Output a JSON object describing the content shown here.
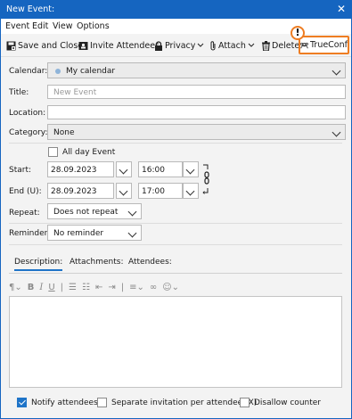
{
  "window": {
    "title": "New Event:",
    "close_glyph": "✕"
  },
  "menu": [
    {
      "label": "Event"
    },
    {
      "label": "Edit"
    },
    {
      "label": "View"
    },
    {
      "label": "Options"
    }
  ],
  "toolbar": {
    "save_close": "Save and Close",
    "invite": "Invite Attendees",
    "privacy": "Privacy",
    "attach": "Attach",
    "delete": "Delete",
    "trueconf": "TrueConf",
    "alert_glyph": "!",
    "accent_color": "#ee7d22"
  },
  "form": {
    "calendar_label": "Calendar:",
    "calendar_value": "My calendar",
    "title_label": "Title:",
    "title_placeholder": "New Event",
    "location_label": "Location:",
    "location_value": "",
    "category_label": "Category:",
    "category_value": "None",
    "allday_label": "All day Event",
    "allday_checked": false,
    "start_label": "Start:",
    "start_date": "28.09.2023",
    "start_time": "16:00",
    "end_label": "End (U):",
    "end_date": "28.09.2023",
    "end_time": "17:00",
    "repeat_label": "Repeat:",
    "repeat_value": "Does not repeat",
    "reminder_label": "Reminder:",
    "reminder_value": "No reminder"
  },
  "tabs": [
    {
      "label": "Description:",
      "active": true
    },
    {
      "label": "Attachments:",
      "active": false
    },
    {
      "label": "Attendees:",
      "active": false
    }
  ],
  "format_toolbar": [
    "paragraph-icon",
    "bold-icon",
    "italic-icon",
    "underline-icon",
    "bullet-list-icon",
    "numbered-list-icon",
    "outdent-icon",
    "indent-icon",
    "align-icon",
    "link-icon",
    "emoji-icon"
  ],
  "bottom": {
    "notify_label": "Notify attendees",
    "notify_checked": true,
    "separate_label": "Separate invitation per attendee (X)",
    "separate_checked": false,
    "disallow_label": "Disallow counter",
    "disallow_checked": false
  },
  "colors": {
    "titlebar": "#1565c0",
    "checkbox_on": "#1f74c8"
  }
}
